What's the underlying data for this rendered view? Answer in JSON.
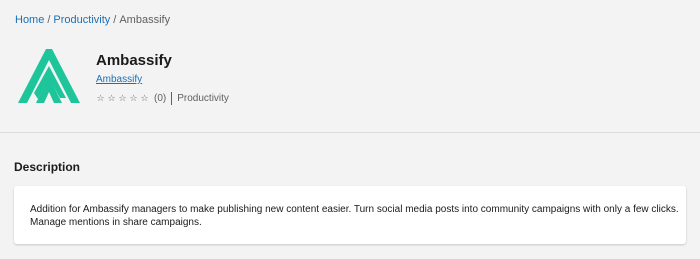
{
  "breadcrumb": {
    "items": [
      "Home",
      "Productivity",
      "Ambassify"
    ],
    "separator": "/"
  },
  "extension": {
    "name": "Ambassify",
    "publisher": "Ambassify",
    "rating": {
      "stars": 0,
      "max": 5,
      "count_text": "(0)"
    },
    "category": "Productivity",
    "logo_color": "#1fc59a",
    "logo_icon": "ambassify-logo-icon"
  },
  "description": {
    "heading": "Description",
    "body": "Addition for Ambassify managers to make publishing new content easier. Turn social media posts into community campaigns with only a few clicks. Manage mentions in share campaigns."
  },
  "colors": {
    "link": "#1a70b8",
    "background": "#f3f3f3",
    "card": "#ffffff"
  }
}
